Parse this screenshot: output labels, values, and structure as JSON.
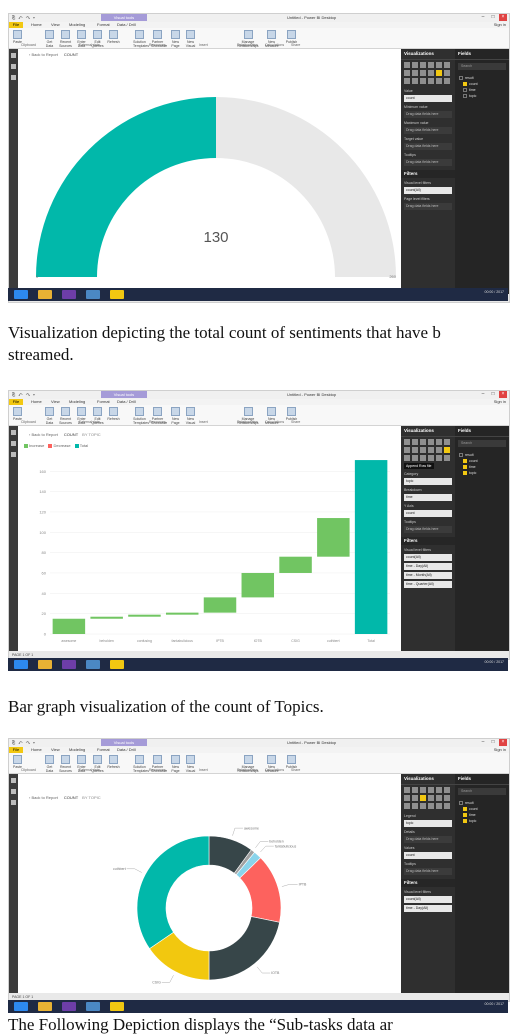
{
  "common": {
    "quick_access": "⎘ ↶ ↷ ▾",
    "context_tab": "Visual tools",
    "window_title": "Untitled - Power BI Desktop",
    "sign_in": "Sign in",
    "menu": [
      "File",
      "Home",
      "View",
      "Modeling",
      "Format",
      "Data / Drill"
    ],
    "ribbon": [
      {
        "label": "Paste"
      },
      {
        "label": "Get Data"
      },
      {
        "label": "Recent Sources"
      },
      {
        "label": "Enter Data"
      },
      {
        "label": "Edit Queries"
      },
      {
        "label": "Refresh"
      },
      {
        "label": "Solution Templates"
      },
      {
        "label": "Partner Showcase"
      },
      {
        "label": "New Page"
      },
      {
        "label": "New Visual"
      },
      {
        "label": "Manage Relationships"
      },
      {
        "label": "New Measure"
      },
      {
        "label": "Publish"
      }
    ],
    "ribbon_small": [
      "Cut",
      "Copy",
      "Format Painter",
      "Text box",
      "Image",
      "Shapes"
    ],
    "ribbon_groups": [
      "Clipboard",
      "External data",
      "Resources",
      "Insert",
      "Relationships",
      "Calculations",
      "Share"
    ],
    "back_label": "Back to Report",
    "visualizations_title": "Visualizations",
    "fields_title": "Fields",
    "search_placeholder": "Search",
    "filters_title": "Filters",
    "page_label": "PAGE 1 OF 1",
    "date_time": "00:00 / 2017"
  },
  "screens": [
    {
      "crumbs": [
        "COUNT"
      ],
      "fields": [
        {
          "name": "result",
          "checked": false,
          "table": true
        },
        {
          "name": "count",
          "checked": true
        },
        {
          "name": "time",
          "checked": false
        },
        {
          "name": "topic",
          "checked": false
        }
      ],
      "wells": [
        {
          "label": "Value",
          "value": "count",
          "selected": true
        },
        {
          "label": "Minimum value",
          "value": "Drag data fields here"
        },
        {
          "label": "Maximum value",
          "value": "Drag data fields here"
        },
        {
          "label": "Target value",
          "value": "Drag data fields here"
        },
        {
          "label": "Tooltips",
          "value": "Drag data fields here"
        }
      ],
      "filters": [
        {
          "label": "Visual level filters",
          "value": "count(All)"
        },
        {
          "label": "Page level filters",
          "value": "Drag data fields here"
        }
      ]
    },
    {
      "crumbs": [
        "COUNT",
        "BY TOPIC"
      ],
      "fields": [
        {
          "name": "result",
          "checked": false,
          "table": true
        },
        {
          "name": "count",
          "checked": true
        },
        {
          "name": "time",
          "checked": true
        },
        {
          "name": "topic",
          "checked": true
        }
      ],
      "wells": [
        {
          "label": "Category",
          "value": "topic",
          "selected": true
        },
        {
          "label": "Breakdown",
          "value": "time",
          "selected": true
        },
        {
          "label": "Y Axis",
          "value": "count",
          "selected": true
        },
        {
          "label": "Tooltips",
          "value": "Drag data fields here"
        }
      ],
      "filters": [
        {
          "label": "Visual level filters",
          "value": "count(All)"
        },
        {
          "label": "",
          "value": "time - Day(All)"
        },
        {
          "label": "",
          "value": "time - Month(All)"
        },
        {
          "label": "",
          "value": "time - Quarter(All)"
        }
      ],
      "tooltip": "Append Row file"
    },
    {
      "crumbs": [
        "COUNT",
        "BY TOPIC"
      ],
      "fields": [
        {
          "name": "result",
          "checked": false,
          "table": true
        },
        {
          "name": "count",
          "checked": true
        },
        {
          "name": "time",
          "checked": true
        },
        {
          "name": "topic",
          "checked": true
        }
      ],
      "wells": [
        {
          "label": "Legend",
          "value": "topic",
          "selected": true
        },
        {
          "label": "Details",
          "value": "Drag data fields here"
        },
        {
          "label": "Values",
          "value": "count",
          "selected": true
        },
        {
          "label": "Tooltips",
          "value": "Drag data fields here"
        }
      ],
      "filters": [
        {
          "label": "Visual level filters",
          "value": "count(All)"
        },
        {
          "label": "",
          "value": "time - Day(All)"
        }
      ]
    }
  ],
  "captions": [
    "Visualization depicting the total count of sentiments that have b",
    "streamed.",
    "Bar graph visualization of the count of Topics.",
    "The Following Depiction displays the “Sub-tasks data ar"
  ],
  "colors": {
    "teal": "#01b8aa",
    "gray": "#374649",
    "red": "#fd625e",
    "yellow": "#f2c80f",
    "green": "#71c562",
    "light": "#e8e8e8"
  },
  "chart_data": [
    {
      "type": "gauge",
      "value": 130,
      "value_label": "130",
      "min": 0,
      "max": 260,
      "min_label": "0",
      "max_label": "260"
    },
    {
      "type": "waterfall",
      "legend": [
        {
          "name": "Increase",
          "color": "#71c562"
        },
        {
          "name": "Decrease",
          "color": "#fd625e"
        },
        {
          "name": "Total",
          "color": "#01b8aa"
        }
      ],
      "categories": [
        "awesome",
        "beholden",
        "confusing",
        "fantabulicious",
        "IPTB",
        "IOTB",
        "CSIG",
        "cuthbert",
        "Total"
      ],
      "values": [
        15,
        2,
        2,
        2,
        15,
        24,
        16,
        38,
        171
      ],
      "y_ticks": [
        "0",
        "20",
        "40",
        "60",
        "80",
        "100",
        "120",
        "140",
        "160"
      ],
      "ylim": [
        0,
        175
      ]
    },
    {
      "type": "donut",
      "categories": [
        "awesome",
        "beholden",
        "fantabulicious",
        "IPTB",
        "IOTB",
        "CSIG",
        "cuthbert"
      ],
      "values": [
        11,
        1,
        2,
        17,
        24,
        17,
        38
      ],
      "colors": [
        "#374649",
        "#a0a0a0",
        "#8ad4eb",
        "#fd625e",
        "#374649",
        "#f2c80f",
        "#01b8aa"
      ]
    }
  ]
}
